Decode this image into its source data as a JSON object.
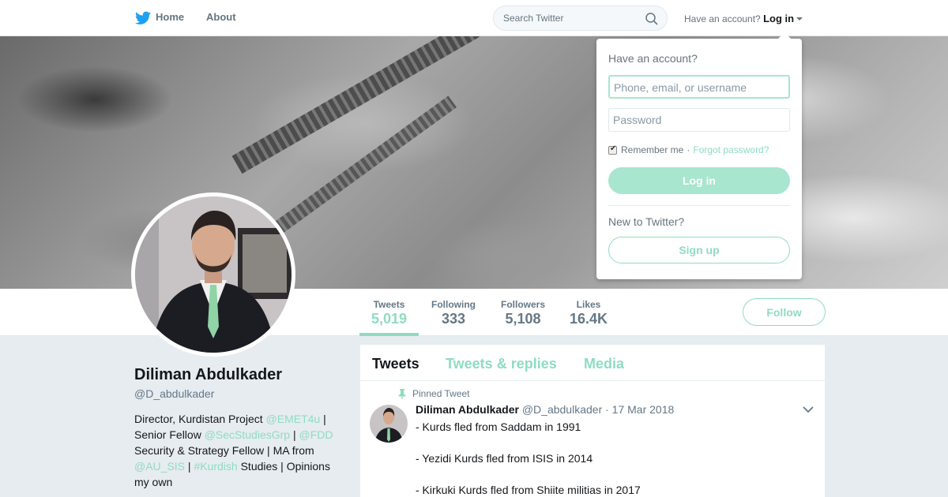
{
  "nav": {
    "home_label": "Home",
    "about_label": "About",
    "search_placeholder": "Search Twitter",
    "have_account_text": "Have an account?",
    "login_label": "Log in"
  },
  "profile": {
    "name": "Diliman Abdulkader",
    "handle": "@D_abdulkader",
    "bio": {
      "line1_text": "Director, Kurdistan Project ",
      "line1_link": "@EMET4u",
      "line1_tail": " |",
      "line2_text": "Senior Fellow ",
      "line2_link1": "@SecStudiesGrp",
      "line2_sep": " | ",
      "line2_link2": "@FDD",
      "line3_text": "Security & Strategy Fellow | MA from",
      "line4_link1": "@AU_SIS",
      "line4_sep": " | ",
      "line4_link2": "#Kurdish",
      "line4_tail": " Studies | Opinions",
      "line5_text": "my own"
    }
  },
  "stats": [
    {
      "label": "Tweets",
      "value": "5,019"
    },
    {
      "label": "Following",
      "value": "333"
    },
    {
      "label": "Followers",
      "value": "5,108"
    },
    {
      "label": "Likes",
      "value": "16.4K"
    }
  ],
  "follow_label": "Follow",
  "tabs": [
    "Tweets",
    "Tweets & replies",
    "Media"
  ],
  "tweet": {
    "pinned_label": "Pinned Tweet",
    "author": "Diliman Abdulkader",
    "handle": "@D_abdulkader",
    "date": "· 17 Mar 2018",
    "lines": [
      "- Kurds fled from Saddam in 1991",
      "- Yezidi Kurds fled from ISIS in 2014",
      "- Kirkuki Kurds fled from Shiite militias in 2017"
    ]
  },
  "login_dropdown": {
    "title": "Have an account?",
    "username_placeholder": "Phone, email, or username",
    "password_placeholder": "Password",
    "remember_label": "Remember me",
    "sep": "·",
    "forgot_label": "Forgot password?",
    "login_button": "Log in",
    "new_label": "New to Twitter?",
    "signup_button": "Sign up"
  },
  "colors": {
    "accent": "#8fdcc0",
    "twitter_blue": "#1da1f2"
  }
}
